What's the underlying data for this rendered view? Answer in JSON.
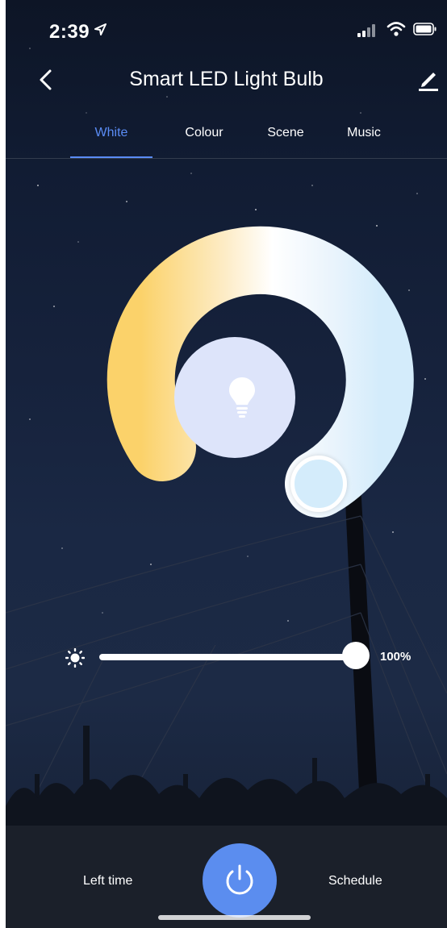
{
  "status_bar": {
    "time": "2:39"
  },
  "nav": {
    "title": "Smart LED Light Bulb"
  },
  "tabs": [
    {
      "label": "White",
      "active": true
    },
    {
      "label": "Colour",
      "active": false
    },
    {
      "label": "Scene",
      "active": false
    },
    {
      "label": "Music",
      "active": false
    }
  ],
  "brightness": {
    "value_label": "100%",
    "level": 1.0
  },
  "bottom_bar": {
    "left_time_label": "Left time",
    "schedule_label": "Schedule"
  },
  "icons": {
    "back": "chevron-left-icon",
    "edit": "pencil-icon",
    "bulb": "lightbulb-icon",
    "brightness": "sun-icon",
    "power": "power-icon"
  },
  "colors": {
    "accent": "#5a8cf5",
    "power_button": "#5b8def",
    "warm": "#fbd26a",
    "cool": "#d4ecfb"
  }
}
